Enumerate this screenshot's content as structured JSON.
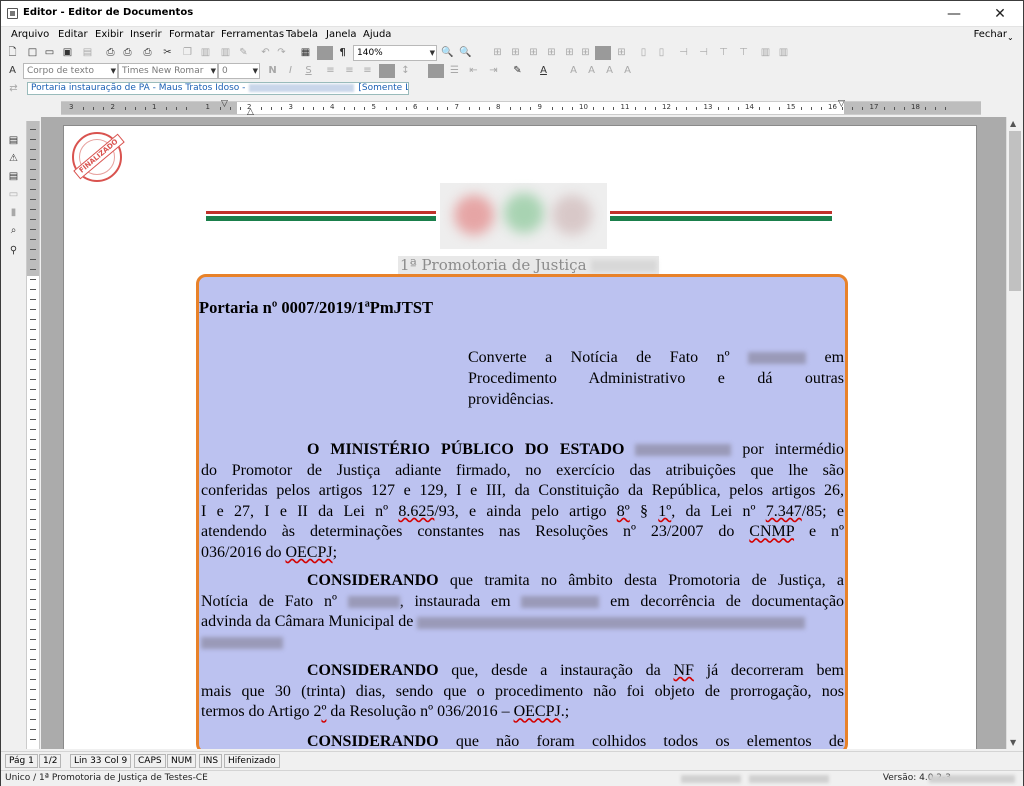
{
  "window": {
    "title": "Editor - Editor de Documentos",
    "minimize": "—",
    "close": "✕"
  },
  "menu": {
    "items": [
      "Arquivo",
      "Editar",
      "Exibir",
      "Inserir",
      "Formatar",
      "Ferramentas",
      "Tabela",
      "Janela",
      "Ajuda"
    ],
    "close_label": "Fechar",
    "close_arrow": "⌄"
  },
  "toolbar": {
    "zoom": "140%",
    "style": "Corpo de texto",
    "font": "Times New Romar",
    "size": "0",
    "pilcrow": "¶",
    "bold": "N",
    "italic": "I",
    "underline": "S"
  },
  "doc_tab": {
    "name": "Portaria instauração de PA - Maus Tratos Idoso -",
    "mode": "[Somente Leitura]"
  },
  "ruler": {
    "labels": [
      "3",
      "2",
      "1",
      "1",
      "2",
      "3",
      "4",
      "5",
      "6",
      "7",
      "8",
      "9",
      "10",
      "11",
      "12",
      "13",
      "14",
      "15",
      "16",
      "17",
      "18"
    ]
  },
  "stamp": {
    "text": "FINALIZADO"
  },
  "letterhead": {
    "promotoria": "1ª Promotoria de Justiça",
    "stripe_red": "#c0312b",
    "stripe_green": "#1a7f4b"
  },
  "document": {
    "heading": "Portaria nº 0007/2019/1ªPmJTST",
    "ementa": [
      "Converte a Notícia de Fato nº",
      "em",
      "Procedimento Administrativo e dá outras",
      "providências."
    ],
    "p1_bold": "O MINISTÉRIO PÚBLICO DO ESTADO",
    "p1_a": "por intermédio",
    "p1_l2": "do Promotor de Justiça adiante firmado, no exercício das atribuições que lhe são",
    "p1_l3": "conferidas pelos artigos 127 e 129, I e III, da Constituição da República, pelos artigos 26,",
    "p1_l4a": "I e 27, I e II da Lei nº ",
    "p1_l4b": "8.625",
    "p1_l4c": "/93, e ainda pelo artigo ",
    "p1_l4d": "8º",
    "p1_l4e": " § ",
    "p1_l4f": "1º",
    "p1_l4g": ", da Lei nº ",
    "p1_l4h": "7.347",
    "p1_l4i": "/85; e",
    "p1_l5a": "atendendo às determinações constantes nas Resoluções nº 23/2007 do ",
    "p1_l5b": "CNMP",
    "p1_l5c": " e nº",
    "p1_l6a": "036/2016 do ",
    "p1_l6b": "OECPJ",
    "p1_l6c": ";",
    "considerando": "CONSIDERANDO",
    "p2_a": " que tramita no âmbito desta Promotoria de Justiça, a",
    "p2_b1": "Notícia de Fato nº",
    "p2_b2": ", instaurada em",
    "p2_b3": "em decorrência de documentação",
    "p2_c": "advinda da Câmara Municipal de",
    "p3_a1": " que, desde a instauração da ",
    "p3_a2": "NF",
    "p3_a3": " já decorreram bem",
    "p3_b": "mais que 30 (trinta) dias, sendo que o procedimento não foi objeto de prorrogação, nos",
    "p3_c1": "termos do Artigo 2",
    "p3_c2": "º",
    "p3_c3": " da Resolução nº 036/2016 – ",
    "p3_c4": "OECPJ",
    "p3_c5": ".;",
    "p4_a": " que não foram colhidos todos os elementos de"
  },
  "status": {
    "page": "Pág 1",
    "pages": "1/2",
    "pos": "Lin 33  Col 9",
    "caps": "CAPS",
    "num": "NUM",
    "ins": "INS",
    "hyph": "Hifenizado"
  },
  "footer": {
    "left": "Unico / 1ª Promotoria de Justiça de Testes-CE",
    "version": "Versão: 4.0.2-3"
  }
}
